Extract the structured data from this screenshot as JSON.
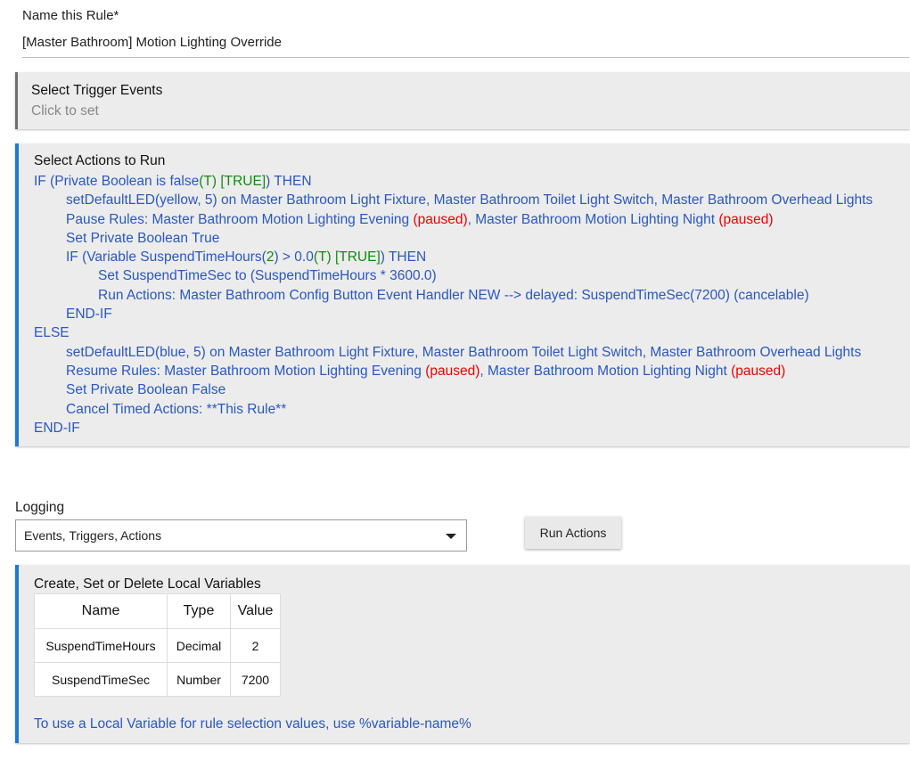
{
  "rule_name": {
    "label": "Name this Rule*",
    "value": "[Master Bathroom] Motion Lighting Override"
  },
  "trigger": {
    "title": "Select Trigger Events",
    "subtitle": "Click to set"
  },
  "actions": {
    "title": "Select Actions to Run",
    "lines": [
      {
        "indent": 0,
        "segments": [
          {
            "text": "IF (Private Boolean is false",
            "color": "blue"
          },
          {
            "text": "(T) [TRUE]",
            "color": "green"
          },
          {
            "text": ") THEN",
            "color": "blue"
          }
        ]
      },
      {
        "indent": 1,
        "segments": [
          {
            "text": "setDefaultLED(yellow, 5) on Master Bathroom Light Fixture, Master Bathroom Toilet Light Switch, Master Bathroom Overhead Lights",
            "color": "blue"
          }
        ]
      },
      {
        "indent": 1,
        "segments": [
          {
            "text": "Pause Rules: Master Bathroom Motion Lighting Evening ",
            "color": "blue"
          },
          {
            "text": "(paused)",
            "color": "red"
          },
          {
            "text": ", Master Bathroom Motion Lighting Night ",
            "color": "blue"
          },
          {
            "text": "(paused)",
            "color": "red"
          }
        ]
      },
      {
        "indent": 1,
        "segments": [
          {
            "text": "Set Private Boolean True",
            "color": "blue"
          }
        ]
      },
      {
        "indent": 1,
        "segments": [
          {
            "text": "IF (Variable SuspendTimeHours(",
            "color": "blue"
          },
          {
            "text": "2",
            "color": "green"
          },
          {
            "text": ") > 0.0",
            "color": "blue"
          },
          {
            "text": "(T) [TRUE]",
            "color": "green"
          },
          {
            "text": ") THEN",
            "color": "blue"
          }
        ]
      },
      {
        "indent": 2,
        "segments": [
          {
            "text": "Set SuspendTimeSec to (SuspendTimeHours * 3600.0)",
            "color": "blue"
          }
        ]
      },
      {
        "indent": 2,
        "segments": [
          {
            "text": "Run Actions: Master Bathroom Config Button Event Handler NEW --> delayed: SuspendTimeSec(7200) (cancelable)",
            "color": "blue"
          }
        ]
      },
      {
        "indent": 1,
        "segments": [
          {
            "text": "END-IF",
            "color": "blue"
          }
        ]
      },
      {
        "indent": 0,
        "segments": [
          {
            "text": "ELSE",
            "color": "blue"
          }
        ]
      },
      {
        "indent": 1,
        "segments": [
          {
            "text": "setDefaultLED(blue, 5) on Master Bathroom Light Fixture, Master Bathroom Toilet Light Switch, Master Bathroom Overhead Lights",
            "color": "blue"
          }
        ]
      },
      {
        "indent": 1,
        "segments": [
          {
            "text": "Resume Rules: Master Bathroom Motion Lighting Evening ",
            "color": "blue"
          },
          {
            "text": "(paused)",
            "color": "red"
          },
          {
            "text": ", Master Bathroom Motion Lighting Night ",
            "color": "blue"
          },
          {
            "text": "(paused)",
            "color": "red"
          }
        ]
      },
      {
        "indent": 1,
        "segments": [
          {
            "text": "Set Private Boolean False",
            "color": "blue"
          }
        ]
      },
      {
        "indent": 1,
        "segments": [
          {
            "text": "Cancel Timed Actions: **This Rule**",
            "color": "blue"
          }
        ]
      },
      {
        "indent": 0,
        "segments": [
          {
            "text": "END-IF",
            "color": "blue"
          }
        ]
      }
    ]
  },
  "logging": {
    "label": "Logging",
    "selected": "Events, Triggers, Actions"
  },
  "run_actions_label": "Run Actions",
  "local_vars": {
    "title": "Create, Set or Delete Local Variables",
    "headers": [
      "Name",
      "Type",
      "Value"
    ],
    "rows": [
      [
        "SuspendTimeHours",
        "Decimal",
        "2"
      ],
      [
        "SuspendTimeSec",
        "Number",
        "7200"
      ]
    ],
    "note": "To use a Local Variable for rule selection values, use %variable-name%"
  },
  "colors": {
    "blue": "#2a57c2",
    "green": "#118a11",
    "red": "#ee0000",
    "accent_bar": "#1e78d8"
  }
}
